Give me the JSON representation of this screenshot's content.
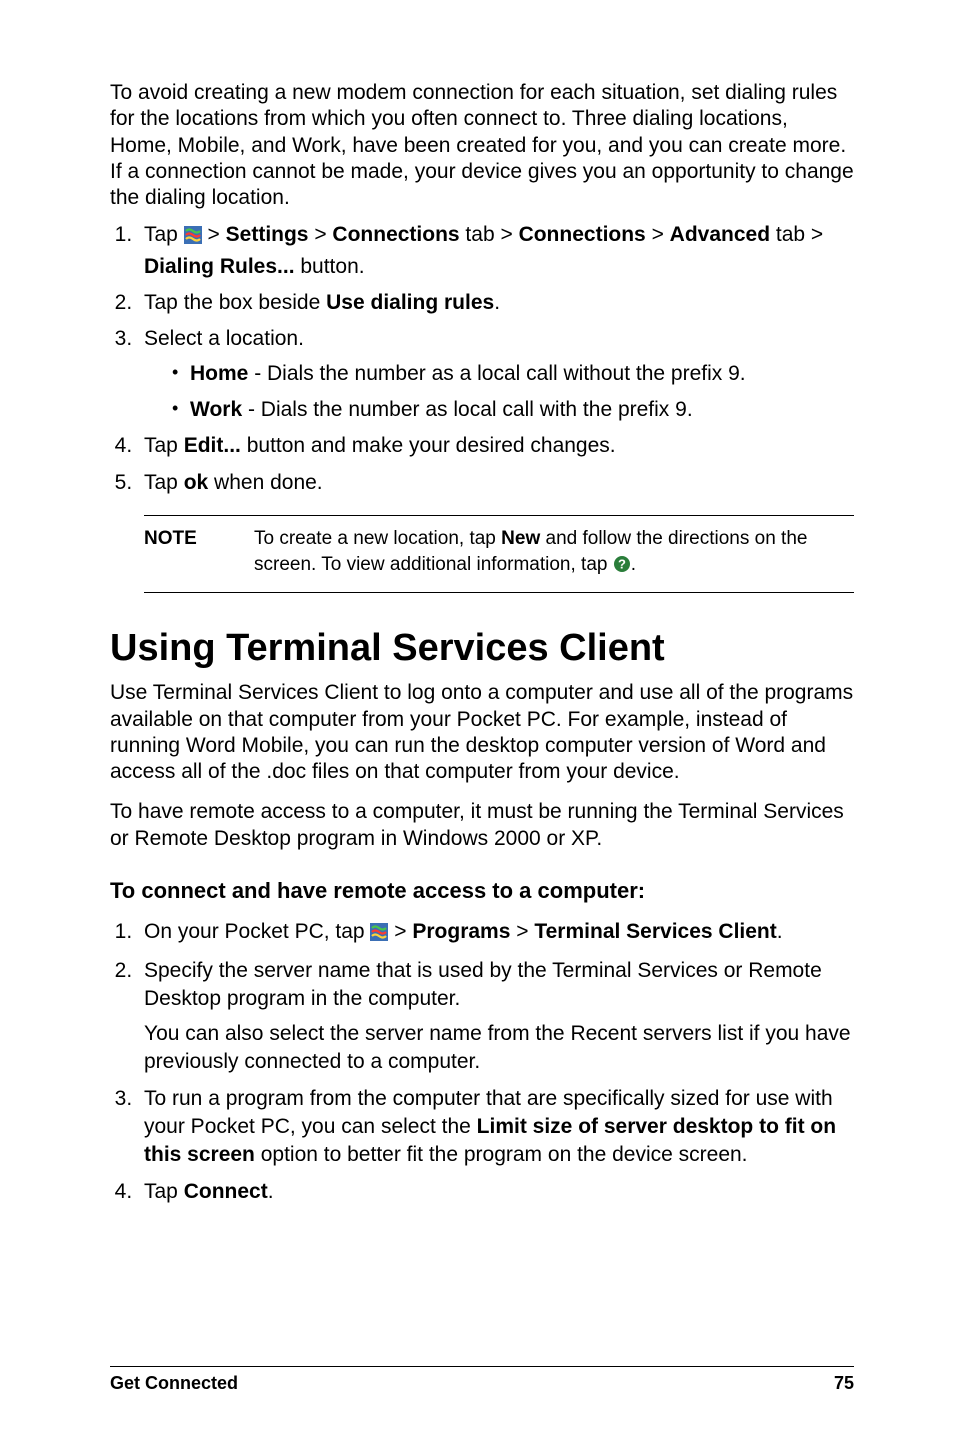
{
  "intro_para": "To avoid creating a new modem connection for each situation, set dialing rules for the locations from which you often connect to. Three dialing locations, Home, Mobile, and Work, have been created for you, and you can create more. If a connection cannot be made, your device gives you an opportunity to change the dialing location.",
  "steps_a": {
    "s1_pre": "Tap ",
    "s1_seg1": " > ",
    "s1_b1": "Settings",
    "s1_seg2": " > ",
    "s1_b2": "Connections",
    "s1_seg3": " tab > ",
    "s1_b3": "Connections",
    "s1_seg4": " > ",
    "s1_b4": "Advanced",
    "s1_seg5": " tab > ",
    "s1_b5": "Dialing Rules...",
    "s1_seg6": " button.",
    "s2_pre": "Tap the box beside ",
    "s2_b1": "Use dialing rules",
    "s2_post": ".",
    "s3": "Select a location.",
    "s3_home_b": "Home",
    "s3_home_t": " - Dials the number as a local call without the prefix 9.",
    "s3_work_b": "Work",
    "s3_work_t": " - Dials the number as local call with the prefix 9.",
    "s4_pre": "Tap ",
    "s4_b1": "Edit...",
    "s4_post": " button and make your desired changes.",
    "s5_pre": "Tap ",
    "s5_b1": "ok",
    "s5_post": " when done."
  },
  "note": {
    "label": "NOTE",
    "t1": "To create a new location, tap ",
    "b1": "New",
    "t2": " and follow the directions on the screen. To view additional information, tap ",
    "t3": "."
  },
  "section_title": "Using Terminal Services Client",
  "tsc_para1": "Use Terminal Services Client to log onto a computer and use all of the programs available on that computer from your Pocket PC. For example, instead of running Word Mobile, you can run the desktop computer version of Word and access all of the .doc files on that computer from your device.",
  "tsc_para2": "To have remote access to a computer, it must be running the Terminal Services or Remote Desktop program in Windows 2000 or XP.",
  "subhead": "To connect and have remote access to a computer:",
  "steps_b": {
    "s1_pre": "On your Pocket PC, tap ",
    "s1_seg1": " > ",
    "s1_b1": "Programs",
    "s1_seg2": " > ",
    "s1_b2": "Terminal Services Client",
    "s1_post": ".",
    "s2_l1": "Specify the server name that is used by the Terminal Services or Remote Desktop program in the computer.",
    "s2_l2": "You can also select the server name from the Recent servers list if you have previously connected to a computer.",
    "s3_pre": "To run a program from the computer that are specifically sized for use with your Pocket PC, you can select the ",
    "s3_b1": "Limit size of server desktop to fit on this screen",
    "s3_post": " option to better fit the program on the device screen.",
    "s4_pre": "Tap ",
    "s4_b1": "Connect",
    "s4_post": "."
  },
  "footer": {
    "left": "Get Connected",
    "right": "75"
  }
}
